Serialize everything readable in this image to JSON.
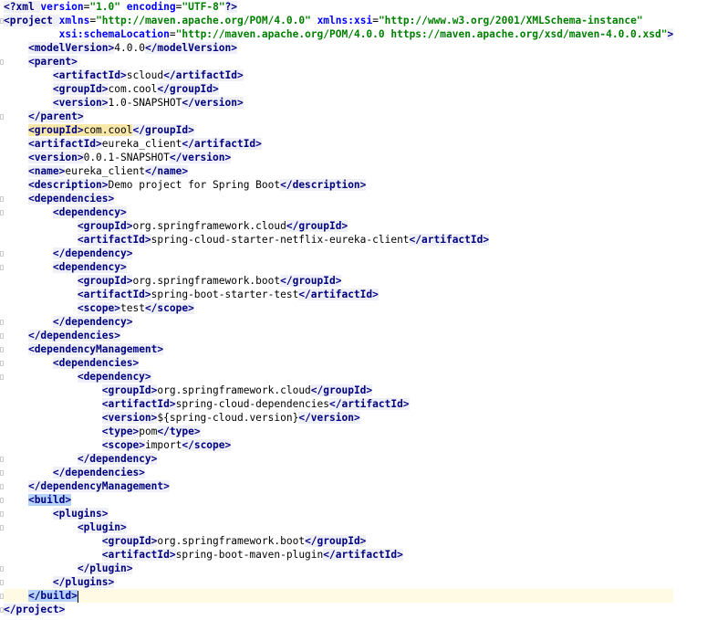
{
  "editor": {
    "lines": [
      {
        "indent": "",
        "parts": [
          {
            "t": "decl",
            "v": "<?xml "
          },
          {
            "t": "aname",
            "v": "version"
          },
          {
            "t": "txt",
            "v": "="
          },
          {
            "t": "aval",
            "v": "\"1.0\""
          },
          {
            "t": "txt",
            "v": " "
          },
          {
            "t": "aname",
            "v": "encoding"
          },
          {
            "t": "txt",
            "v": "="
          },
          {
            "t": "aval",
            "v": "\"UTF-8\""
          },
          {
            "t": "decl",
            "v": "?>"
          }
        ]
      },
      {
        "indent": "",
        "parts": [
          {
            "t": "tag",
            "v": "<project "
          },
          {
            "t": "aname",
            "v": "xmlns"
          },
          {
            "t": "txt",
            "v": "="
          },
          {
            "t": "aval",
            "v": "\"http://maven.apache.org/POM/4.0.0\""
          },
          {
            "t": "txt",
            "v": " "
          },
          {
            "t": "aname",
            "v": "xmlns:xsi"
          },
          {
            "t": "txt",
            "v": "="
          },
          {
            "t": "aval",
            "v": "\"http://www.w3.org/2001/XMLSchema-instance\""
          }
        ]
      },
      {
        "indent": "         ",
        "parts": [
          {
            "t": "aname",
            "v": "xsi:schemaLocation"
          },
          {
            "t": "txt",
            "v": "="
          },
          {
            "t": "aval",
            "v": "\"http://maven.apache.org/POM/4.0.0 https://maven.apache.org/xsd/maven-4.0.0.xsd\""
          },
          {
            "t": "tag",
            "v": ">"
          }
        ]
      },
      {
        "indent": "    ",
        "parts": [
          {
            "t": "tag",
            "v": "<modelVersion>"
          },
          {
            "t": "txt",
            "v": "4.0.0"
          },
          {
            "t": "tag",
            "v": "</modelVersion>"
          }
        ]
      },
      {
        "indent": "    ",
        "parts": [
          {
            "t": "tag",
            "v": "<parent>"
          }
        ]
      },
      {
        "indent": "        ",
        "parts": [
          {
            "t": "tag",
            "v": "<artifactId>"
          },
          {
            "t": "txt",
            "v": "scloud"
          },
          {
            "t": "tag",
            "v": "</artifactId>"
          }
        ]
      },
      {
        "indent": "        ",
        "parts": [
          {
            "t": "tag",
            "v": "<groupId>"
          },
          {
            "t": "txt",
            "v": "com.cool"
          },
          {
            "t": "tag",
            "v": "</groupId>"
          }
        ]
      },
      {
        "indent": "        ",
        "parts": [
          {
            "t": "tag",
            "v": "<version>"
          },
          {
            "t": "txt",
            "v": "1.0-SNAPSHOT"
          },
          {
            "t": "tag",
            "v": "</version>"
          }
        ]
      },
      {
        "indent": "    ",
        "parts": [
          {
            "t": "tag",
            "v": "</parent>"
          }
        ]
      },
      {
        "indent": "    ",
        "parts": [
          {
            "t": "taghl",
            "v": "<groupId>"
          },
          {
            "t": "txthl",
            "v": "com.cool"
          },
          {
            "t": "tag",
            "v": "</groupId>"
          }
        ]
      },
      {
        "indent": "    ",
        "parts": [
          {
            "t": "tag",
            "v": "<artifactId>"
          },
          {
            "t": "txt",
            "v": "eureka_client"
          },
          {
            "t": "tag",
            "v": "</artifactId>"
          }
        ]
      },
      {
        "indent": "    ",
        "parts": [
          {
            "t": "tag",
            "v": "<version>"
          },
          {
            "t": "txt",
            "v": "0.0.1-SNAPSHOT"
          },
          {
            "t": "tag",
            "v": "</version>"
          }
        ]
      },
      {
        "indent": "    ",
        "parts": [
          {
            "t": "tag",
            "v": "<name>"
          },
          {
            "t": "txt",
            "v": "eureka_client"
          },
          {
            "t": "tag",
            "v": "</name>"
          }
        ]
      },
      {
        "indent": "    ",
        "parts": [
          {
            "t": "tag",
            "v": "<description>"
          },
          {
            "t": "txt",
            "v": "Demo project for Spring Boot"
          },
          {
            "t": "tag",
            "v": "</description>"
          }
        ]
      },
      {
        "indent": "    ",
        "parts": [
          {
            "t": "tag",
            "v": "<dependencies>"
          }
        ]
      },
      {
        "indent": "        ",
        "parts": [
          {
            "t": "tag",
            "v": "<dependency>"
          }
        ]
      },
      {
        "indent": "            ",
        "parts": [
          {
            "t": "tag",
            "v": "<groupId>"
          },
          {
            "t": "txt",
            "v": "org.springframework.cloud"
          },
          {
            "t": "tag",
            "v": "</groupId>"
          }
        ]
      },
      {
        "indent": "            ",
        "parts": [
          {
            "t": "tag",
            "v": "<artifactId>"
          },
          {
            "t": "txt",
            "v": "spring-cloud-starter-netflix-eureka-client"
          },
          {
            "t": "tag",
            "v": "</artifactId>"
          }
        ]
      },
      {
        "indent": "        ",
        "parts": [
          {
            "t": "tag",
            "v": "</dependency>"
          }
        ]
      },
      {
        "indent": "        ",
        "parts": [
          {
            "t": "tag",
            "v": "<dependency>"
          }
        ]
      },
      {
        "indent": "            ",
        "parts": [
          {
            "t": "tag",
            "v": "<groupId>"
          },
          {
            "t": "txt",
            "v": "org.springframework.boot"
          },
          {
            "t": "tag",
            "v": "</groupId>"
          }
        ]
      },
      {
        "indent": "            ",
        "parts": [
          {
            "t": "tag",
            "v": "<artifactId>"
          },
          {
            "t": "txt",
            "v": "spring-boot-starter-test"
          },
          {
            "t": "tag",
            "v": "</artifactId>"
          }
        ]
      },
      {
        "indent": "            ",
        "parts": [
          {
            "t": "tag",
            "v": "<scope>"
          },
          {
            "t": "txt",
            "v": "test"
          },
          {
            "t": "tag",
            "v": "</scope>"
          }
        ]
      },
      {
        "indent": "        ",
        "parts": [
          {
            "t": "tag",
            "v": "</dependency>"
          }
        ]
      },
      {
        "indent": "    ",
        "parts": [
          {
            "t": "tag",
            "v": "</dependencies>"
          }
        ]
      },
      {
        "indent": "    ",
        "parts": [
          {
            "t": "tag",
            "v": "<dependencyManagement>"
          }
        ]
      },
      {
        "indent": "        ",
        "parts": [
          {
            "t": "tag",
            "v": "<dependencies>"
          }
        ]
      },
      {
        "indent": "            ",
        "parts": [
          {
            "t": "tag",
            "v": "<dependency>"
          }
        ]
      },
      {
        "indent": "                ",
        "parts": [
          {
            "t": "tag",
            "v": "<groupId>"
          },
          {
            "t": "txt",
            "v": "org.springframework.cloud"
          },
          {
            "t": "tag",
            "v": "</groupId>"
          }
        ]
      },
      {
        "indent": "                ",
        "parts": [
          {
            "t": "tag",
            "v": "<artifactId>"
          },
          {
            "t": "txt",
            "v": "spring-cloud-dependencies"
          },
          {
            "t": "tag",
            "v": "</artifactId>"
          }
        ]
      },
      {
        "indent": "                ",
        "parts": [
          {
            "t": "tag",
            "v": "<version>"
          },
          {
            "t": "txt",
            "v": "${spring-cloud.version}"
          },
          {
            "t": "tag",
            "v": "</version>"
          }
        ]
      },
      {
        "indent": "                ",
        "parts": [
          {
            "t": "tag",
            "v": "<type>"
          },
          {
            "t": "txt",
            "v": "pom"
          },
          {
            "t": "tag",
            "v": "</type>"
          }
        ]
      },
      {
        "indent": "                ",
        "parts": [
          {
            "t": "tag",
            "v": "<scope>"
          },
          {
            "t": "txt",
            "v": "import"
          },
          {
            "t": "tag",
            "v": "</scope>"
          }
        ]
      },
      {
        "indent": "            ",
        "parts": [
          {
            "t": "tag",
            "v": "</dependency>"
          }
        ]
      },
      {
        "indent": "        ",
        "parts": [
          {
            "t": "tag",
            "v": "</dependencies>"
          }
        ]
      },
      {
        "indent": "    ",
        "parts": [
          {
            "t": "tag",
            "v": "</dependencyManagement>"
          }
        ]
      },
      {
        "indent": "    ",
        "parts": [
          {
            "t": "tagsel",
            "v": "<build>"
          }
        ]
      },
      {
        "indent": "        ",
        "parts": [
          {
            "t": "tag",
            "v": "<plugins>"
          }
        ]
      },
      {
        "indent": "            ",
        "parts": [
          {
            "t": "tag",
            "v": "<plugin>"
          }
        ]
      },
      {
        "indent": "                ",
        "parts": [
          {
            "t": "tag",
            "v": "<groupId>"
          },
          {
            "t": "txt",
            "v": "org.springframework.boot"
          },
          {
            "t": "tag",
            "v": "</groupId>"
          }
        ]
      },
      {
        "indent": "                ",
        "parts": [
          {
            "t": "tag",
            "v": "<artifactId>"
          },
          {
            "t": "txt",
            "v": "spring-boot-maven-plugin"
          },
          {
            "t": "tag",
            "v": "</artifactId>"
          }
        ]
      },
      {
        "indent": "            ",
        "parts": [
          {
            "t": "tag",
            "v": "</plugin>"
          }
        ]
      },
      {
        "indent": "        ",
        "parts": [
          {
            "t": "tag",
            "v": "</plugins>"
          }
        ]
      },
      {
        "indent": "    ",
        "parts": [
          {
            "t": "tagsel",
            "v": "</build>"
          }
        ],
        "caret": true
      },
      {
        "indent": "",
        "parts": [
          {
            "t": "tag",
            "v": "</project>"
          }
        ]
      }
    ]
  }
}
